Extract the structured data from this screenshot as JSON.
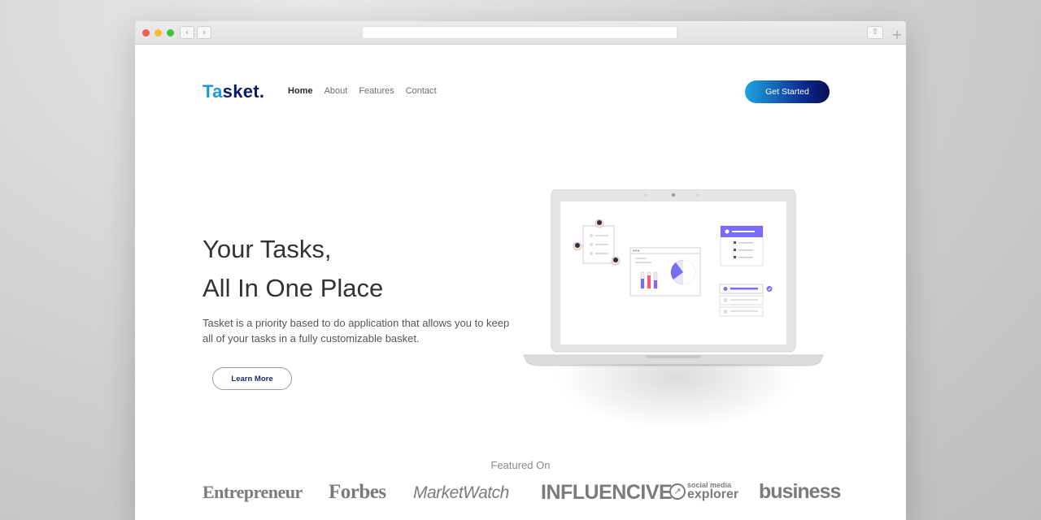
{
  "browser": {
    "back_icon": "chevron-left-icon",
    "forward_icon": "chevron-right-icon",
    "share_icon": "share-icon",
    "new_tab_icon": "plus-icon",
    "back_glyph": "‹",
    "forward_glyph": "›",
    "share_glyph": "⇧",
    "new_tab_glyph": "+"
  },
  "header": {
    "logo_part1": "Ta",
    "logo_part2": "sket.",
    "nav": [
      "Home",
      "About",
      "Features",
      "Contact"
    ],
    "active_nav": "Home",
    "cta_label": "Get Started"
  },
  "hero": {
    "headline_line1": "Your Tasks,",
    "headline_line2": "All In One Place",
    "description": "Tasket is a priority based to do application that allows you to keep all of your tasks in a fully customizable basket.",
    "learn_more_label": "Learn More"
  },
  "featured": {
    "title": "Featured On",
    "brands": [
      "Entrepreneur",
      "Forbes",
      "MarketWatch",
      "INFLUENCIVE",
      "social media",
      "explorer",
      "business"
    ]
  },
  "colors": {
    "logo_primary": "#1b9ad6",
    "logo_secondary": "#0d1a6b",
    "cta_gradient_start": "#1fa4e0",
    "cta_gradient_end": "#070e55",
    "illustration_accent": "#7b6cf6"
  }
}
